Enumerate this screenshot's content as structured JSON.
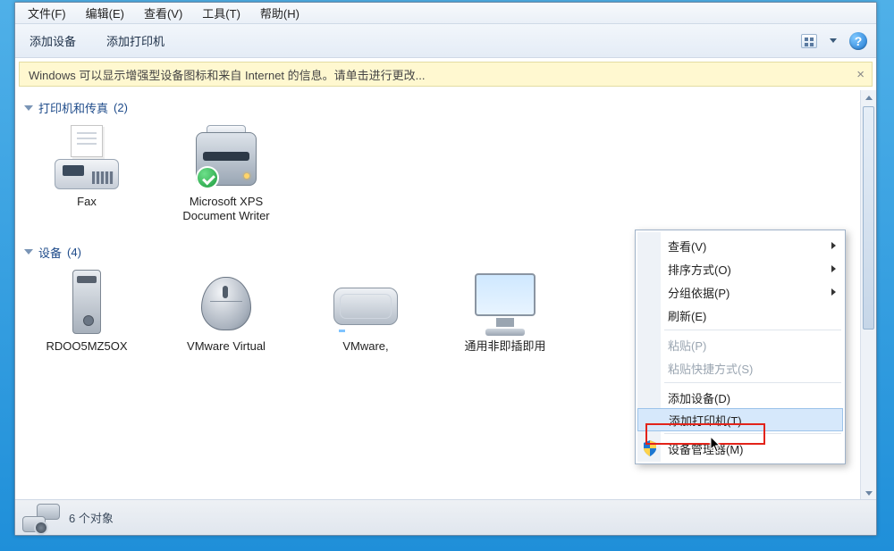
{
  "menubar": {
    "file": "文件(F)",
    "edit": "编辑(E)",
    "view": "查看(V)",
    "tools": "工具(T)",
    "help": "帮助(H)"
  },
  "toolbar": {
    "add_device": "添加设备",
    "add_printer": "添加打印机"
  },
  "infobar": {
    "text": "Windows 可以显示增强型设备图标和来自 Internet 的信息。请单击进行更改..."
  },
  "groups": {
    "printers": {
      "title": "打印机和传真",
      "count": "(2)"
    },
    "devices": {
      "title": "设备",
      "count": "(4)"
    }
  },
  "printers": {
    "fax": "Fax",
    "xps": "Microsoft XPS Document Writer"
  },
  "devices": {
    "tower": "RDOO5MZ5OX",
    "mouse": "VMware Virtual",
    "hdd": "VMware,",
    "monitor": "通用非即插即用"
  },
  "statusbar": {
    "count": "6 个对象"
  },
  "context_menu": {
    "view": "查看(V)",
    "sort": "排序方式(O)",
    "group": "分组依据(P)",
    "refresh": "刷新(E)",
    "paste": "粘贴(P)",
    "paste_shortcut": "粘贴快捷方式(S)",
    "add_device": "添加设备(D)",
    "add_printer": "添加打印机(T)",
    "device_manager": "设备管理器(M)"
  }
}
